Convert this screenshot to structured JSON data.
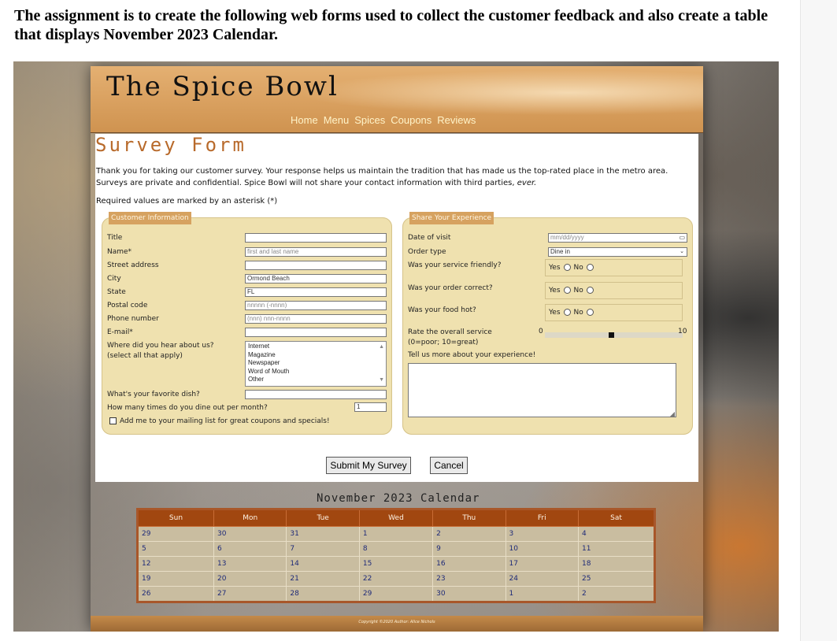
{
  "assignment_text": "The assignment is to create the following web forms used to collect the customer feedback and also create a table that displays November 2023 Calendar.",
  "site": {
    "logo": "The Spice Bowl",
    "nav": [
      "Home",
      "Menu",
      "Spices",
      "Coupons",
      "Reviews"
    ]
  },
  "survey": {
    "title": "Survey Form",
    "intro": "Thank you for taking our customer survey. Your response helps us maintain the tradition that has made us the top-rated place in the metro area. Surveys are private and confidential. Spice Bowl will not share your contact information with third parties,",
    "intro_em": "ever.",
    "required_note": "Required values are marked by an asterisk (*)"
  },
  "customer_info": {
    "legend": "Customer Information",
    "fields": [
      {
        "label": "Title",
        "value": "",
        "placeholder": ""
      },
      {
        "label": "Name*",
        "value": "",
        "placeholder": "first and last name"
      },
      {
        "label": "Street address",
        "value": "",
        "placeholder": ""
      },
      {
        "label": "City",
        "value": "Ormond Beach",
        "placeholder": ""
      },
      {
        "label": "State",
        "value": "FL",
        "placeholder": ""
      },
      {
        "label": "Postal code",
        "value": "",
        "placeholder": "nnnnn (-nnnn)"
      },
      {
        "label": "Phone number",
        "value": "",
        "placeholder": "(nnn) nnn-nnnn"
      },
      {
        "label": "E-mail*",
        "value": "",
        "placeholder": ""
      }
    ],
    "hear_label_1": "Where did you hear about us?",
    "hear_label_2": "(select all that apply)",
    "hear_options": [
      "Internet",
      "Magazine",
      "Newspaper",
      "Word of Mouth",
      "Other"
    ],
    "dish_label": "What's your favorite dish?",
    "dish_value": "",
    "dine_label": "How many times do you dine out per month?",
    "dine_value": "1",
    "mailing_label": "Add me to your mailing list for great coupons and specials!",
    "mailing_checked": false
  },
  "experience": {
    "legend": "Share Your Experience",
    "date_label": "Date of visit",
    "date_placeholder": "mm/dd/yyyy",
    "order_label": "Order type",
    "order_value": "Dine in",
    "friendly_label": "Was your service friendly?",
    "correct_label": "Was your order correct?",
    "hot_label": "Was your food hot?",
    "yes": "Yes",
    "no": "No",
    "rate_label_1": "Rate the overall service",
    "rate_label_2": "(0=poor; 10=great)",
    "rate_min": "0",
    "rate_max": "10",
    "rate_value": 5,
    "comments_label": "Tell us more about your experience!"
  },
  "buttons": {
    "submit": "Submit My Survey",
    "cancel": "Cancel"
  },
  "calendar": {
    "title": "November 2023 Calendar",
    "days": [
      "Sun",
      "Mon",
      "Tue",
      "Wed",
      "Thu",
      "Fri",
      "Sat"
    ],
    "weeks": [
      [
        "29",
        "30",
        "31",
        "1",
        "2",
        "3",
        "4"
      ],
      [
        "5",
        "6",
        "7",
        "8",
        "9",
        "10",
        "11"
      ],
      [
        "12",
        "13",
        "14",
        "15",
        "16",
        "17",
        "18"
      ],
      [
        "19",
        "20",
        "21",
        "22",
        "23",
        "24",
        "25"
      ],
      [
        "26",
        "27",
        "28",
        "29",
        "30",
        "1",
        "2"
      ]
    ]
  },
  "footer": "Copyright ©2020 Author: Alice Nichols"
}
